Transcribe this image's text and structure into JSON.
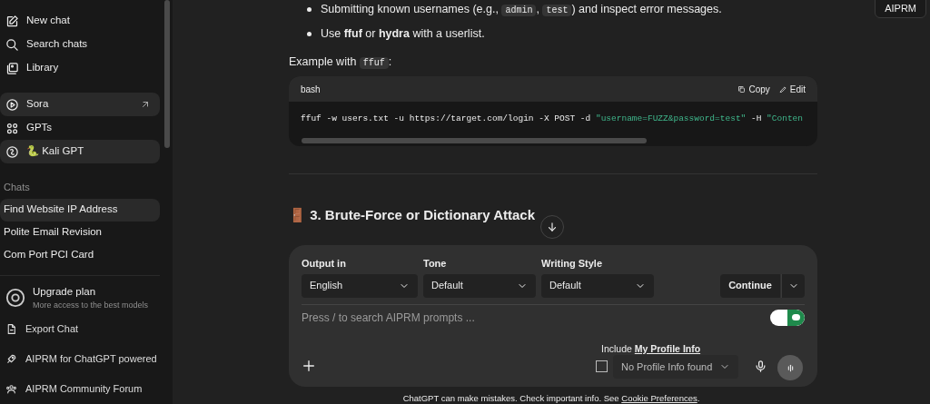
{
  "sidebar": {
    "nav": [
      {
        "label": "New chat",
        "highlighted": false,
        "external": false
      },
      {
        "label": "Search chats",
        "highlighted": false,
        "external": false
      },
      {
        "label": "Library",
        "highlighted": false,
        "external": false
      }
    ],
    "nav2": [
      {
        "label": "Sora",
        "highlighted": true,
        "external": true
      },
      {
        "label": "GPTs",
        "highlighted": false,
        "external": false
      },
      {
        "label": "🐍 Kali GPT",
        "highlighted": true,
        "external": false
      }
    ],
    "chats_heading": "Chats",
    "chats": [
      {
        "title": "Find Website IP Address",
        "selected": true
      },
      {
        "title": "Polite Email Revision",
        "selected": false
      },
      {
        "title": "Com Port PCI Card",
        "selected": false
      }
    ],
    "upgrade": {
      "title": "Upgrade plan",
      "subtitle": "More access to the best models"
    },
    "bottom_links": [
      "Export Chat",
      "AIPRM for ChatGPT powered",
      "AIPRM Community Forum"
    ]
  },
  "top_button": "AIPRM",
  "message": {
    "bullets": [
      [
        {
          "kind": "text",
          "text": "Submitting known usernames (e.g., "
        },
        {
          "kind": "code",
          "text": "admin"
        },
        {
          "kind": "text",
          "text": ", "
        },
        {
          "kind": "code",
          "text": "test"
        },
        {
          "kind": "text",
          "text": ") and inspect error messages."
        }
      ],
      [
        {
          "kind": "text",
          "text": "Use **ffuf** or **hydra** with a userlist."
        }
      ]
    ],
    "example_label": [
      {
        "kind": "text",
        "text": "Example with "
      },
      {
        "kind": "code",
        "text": "ffuf"
      },
      {
        "kind": "text",
        "text": ":"
      }
    ],
    "code_block": {
      "language": "bash",
      "copy": "Copy",
      "edit": "Edit",
      "code_plain": "ffuf -w users.txt -u https://target.com/login -X POST -d ",
      "code_string": "\"username=FUZZ&password=test\"",
      "code_rest": " -H ",
      "code_string2": "\"Conten"
    },
    "heading": "🚪 3. Brute-Force or Dictionary Attack"
  },
  "composer": {
    "selects": [
      {
        "label": "Output in",
        "value": "English"
      },
      {
        "label": "Tone",
        "value": "Default"
      },
      {
        "label": "Writing Style",
        "value": "Default"
      }
    ],
    "continue": "Continue",
    "placeholder": "Press / to search AIPRM prompts ...",
    "prompts_toggle_on": true,
    "include_prefix": "Include",
    "include_link": "My Profile Info",
    "profile_checked": false,
    "profile_select": "No Profile Info found"
  },
  "footer": {
    "text": "ChatGPT can make mistakes. Check important info. See",
    "link": "Cookie Preferences",
    "end": "."
  }
}
